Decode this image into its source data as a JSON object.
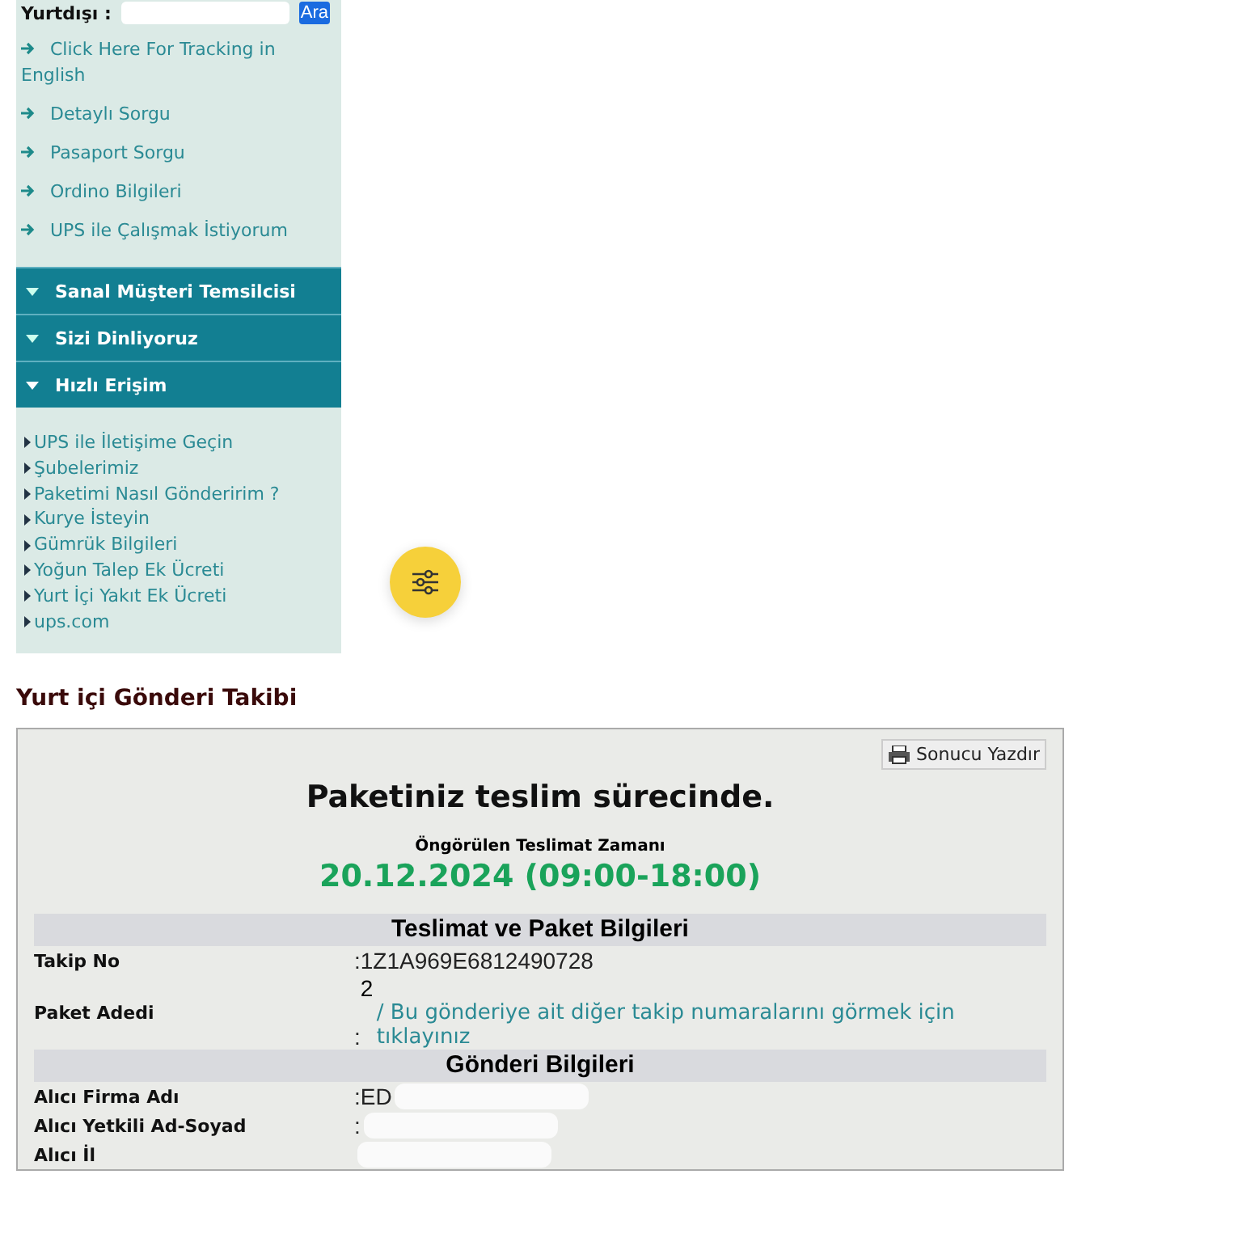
{
  "search": {
    "label": "Yurtdışı :",
    "button": "Ara"
  },
  "links": [
    "Click Here For Tracking in English",
    "Detaylı Sorgu",
    "Pasaport Sorgu",
    "Ordino Bilgileri",
    "UPS ile Çalışmak İstiyorum"
  ],
  "sections": [
    {
      "label": "Sanal Müşteri Temsilcisi",
      "expanded": false
    },
    {
      "label": "Sizi Dinliyoruz",
      "expanded": false
    },
    {
      "label": "Hızlı Erişim",
      "expanded": true
    }
  ],
  "quick_links": [
    "UPS ile İletişime Geçin",
    "Şubelerimiz",
    "Paketimi Nasıl Gönderirim ?",
    "Kurye İsteyin",
    "Gümrük Bilgileri",
    "Yoğun Talep Ek Ücreti",
    "Yurt İçi Yakıt Ek Ücreti",
    "ups.com"
  ],
  "heading": "Yurt içi Gönderi Takibi",
  "result": {
    "print_button": "Sonucu Yazdır",
    "status": "Paketiniz teslim sürecinde.",
    "eta_label": "Öngörülen Teslimat Zamanı",
    "eta": "20.12.2024 (09:00-18:00)",
    "groups": [
      {
        "title": "Teslimat ve Paket Bilgileri",
        "rows": [
          {
            "label": "Takip No",
            "value": ":1Z1A969E6812490728"
          },
          {
            "label": "Paket Adedi",
            "value": ":",
            "count": "2",
            "link": "/  Bu gönderiye ait diğer takip numaralarını görmek için tıklayınız"
          }
        ]
      },
      {
        "title": "Gönderi Bilgileri",
        "rows": [
          {
            "label": "Alıcı Firma Adı",
            "value": ":ED",
            "redacted": true
          },
          {
            "label": "Alıcı Yetkili Ad-Soyad",
            "value": ":",
            "redacted": true
          },
          {
            "label": "Alıcı İl",
            "value": "",
            "redacted": true
          }
        ]
      }
    ]
  }
}
